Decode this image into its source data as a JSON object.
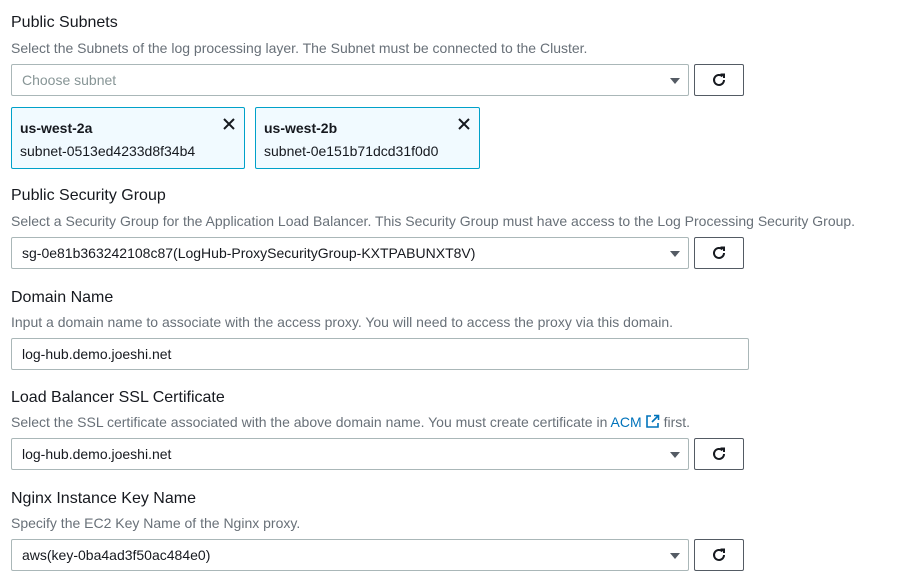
{
  "subnets": {
    "label": "Public Subnets",
    "description": "Select the Subnets of the log processing layer. The Subnet must be connected to the Cluster.",
    "placeholder": "Choose subnet",
    "tokens": [
      {
        "name": "us-west-2a",
        "id": "subnet-0513ed4233d8f34b4"
      },
      {
        "name": "us-west-2b",
        "id": "subnet-0e151b71dcd31f0d0"
      }
    ]
  },
  "security_group": {
    "label": "Public Security Group",
    "description": "Select a Security Group for the Application Load Balancer. This Security Group must have access to the Log Processing Security Group.",
    "value": "sg-0e81b363242108c87(LogHub-ProxySecurityGroup-KXTPABUNXT8V)"
  },
  "domain": {
    "label": "Domain Name",
    "description": "Input a domain name to associate with the access proxy. You will need to access the proxy via this domain.",
    "value": "log-hub.demo.joeshi.net"
  },
  "certificate": {
    "label": "Load Balancer SSL Certificate",
    "description_prefix": "Select the SSL certificate associated with the above domain name. You must create certificate in",
    "link_text": "ACM",
    "description_suffix": "first.",
    "value": "log-hub.demo.joeshi.net"
  },
  "key_name": {
    "label": "Nginx Instance Key Name",
    "description": "Specify the EC2 Key Name of the Nginx proxy.",
    "value": "aws(key-0ba4ad3f50ac484e0)"
  },
  "colors": {
    "link": "#0073bb",
    "token_border": "#00a1c9",
    "token_bg": "#f1faff"
  }
}
